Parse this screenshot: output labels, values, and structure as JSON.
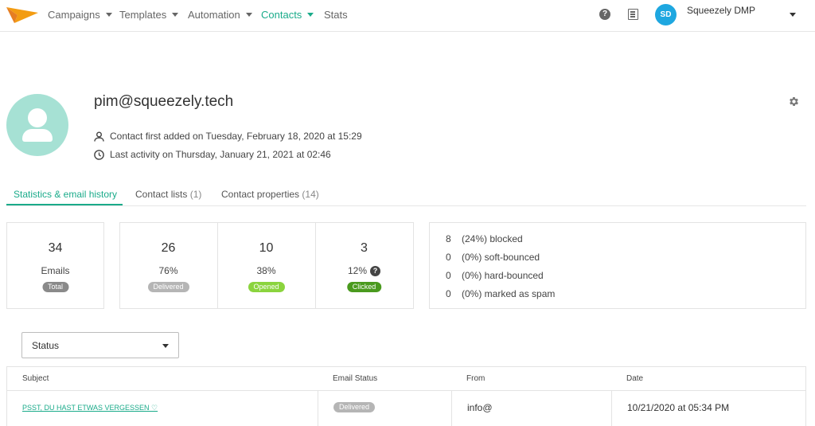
{
  "nav": {
    "items": [
      {
        "label": "Campaigns",
        "has_menu": true,
        "active": false
      },
      {
        "label": "Templates",
        "has_menu": true,
        "active": false
      },
      {
        "label": "Automation",
        "has_menu": true,
        "active": false
      },
      {
        "label": "Contacts",
        "has_menu": true,
        "active": true
      },
      {
        "label": "Stats",
        "has_menu": false,
        "active": false
      }
    ],
    "avatar_initials": "SD",
    "account_name": "Squeezely DMP",
    "help_icon": "?",
    "icons": [
      "help-icon",
      "documents-icon",
      "chevron-down-icon"
    ]
  },
  "contact": {
    "email": "pim@squeezely.tech",
    "first_added": "Contact first added on Tuesday, February 18, 2020 at 15:29",
    "last_activity": "Last activity on Thursday, January 21, 2021 at 02:46"
  },
  "tabs": [
    {
      "label": "Statistics & email history",
      "count": "",
      "active": true
    },
    {
      "label": "Contact lists",
      "count": "(1)",
      "active": false
    },
    {
      "label": "Contact properties",
      "count": "(14)",
      "active": false
    }
  ],
  "stats": {
    "emails": {
      "value": "34",
      "label": "Emails",
      "badge": "Total",
      "badge_color": "#8a8a8a"
    },
    "delivered": {
      "value": "26",
      "label": "76%",
      "badge": "Delivered",
      "badge_color": "#b5b5b5"
    },
    "opened": {
      "value": "10",
      "label": "38%",
      "badge": "Opened",
      "badge_color": "#8bd43e"
    },
    "clicked": {
      "value": "3",
      "label": "12%",
      "badge": "Clicked",
      "badge_color": "#4a9a1e",
      "help_icon": "?"
    }
  },
  "bounces": [
    {
      "count": "8",
      "text": "(24%) blocked"
    },
    {
      "count": "0",
      "text": "(0%) soft-bounced"
    },
    {
      "count": "0",
      "text": "(0%) hard-bounced"
    },
    {
      "count": "0",
      "text": "(0%) marked as spam"
    }
  ],
  "filter": {
    "label": "Status"
  },
  "table": {
    "headers": {
      "subject": "Subject",
      "email_status": "Email Status",
      "from": "From",
      "date": "Date"
    },
    "rows": [
      {
        "subject": "PSST, DU HAST ETWAS VERGESSEN ♡",
        "status": "Delivered",
        "from": "info@",
        "date": "10/21/2020 at 05:34 PM"
      }
    ]
  },
  "colors": {
    "accent": "#1aab8a",
    "avatar_bg": "#a6e1d4",
    "account_avatar": "#1ea7e0"
  }
}
